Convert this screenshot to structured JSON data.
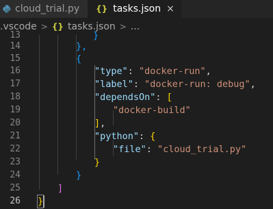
{
  "tabs": [
    {
      "label": "cloud_trial.py",
      "icon": "python-icon",
      "active": false
    },
    {
      "label": "tasks.json",
      "icon": "json-braces-icon",
      "icon_glyph": "{}",
      "active": true,
      "close_glyph": "×"
    }
  ],
  "breadcrumb": {
    "folder": ".vscode",
    "separator": ">",
    "file_icon_glyph": "{}",
    "file": "tasks.json",
    "ellipsis": "..."
  },
  "editor": {
    "current_line": 26,
    "lines": [
      {
        "num": "13",
        "text": "}"
      },
      {
        "num": "14",
        "text": "},"
      },
      {
        "num": "15",
        "text": "{"
      },
      {
        "num": "16",
        "key": "\"type\"",
        "colon": ": ",
        "value": "\"docker-run\"",
        "end": ","
      },
      {
        "num": "17",
        "key": "\"label\"",
        "colon": ": ",
        "value": "\"docker-run: debug\"",
        "end": ","
      },
      {
        "num": "18",
        "key": "\"dependsOn\"",
        "colon": ": ",
        "bracket": "["
      },
      {
        "num": "19",
        "value": "\"docker-build\""
      },
      {
        "num": "20",
        "bracket": "]",
        "end": ","
      },
      {
        "num": "21",
        "key": "\"python\"",
        "colon": ": ",
        "bracket": "{"
      },
      {
        "num": "22",
        "key": "\"file\"",
        "colon": ": ",
        "value": "\"cloud_trial.py\""
      },
      {
        "num": "23",
        "bracket": "}"
      },
      {
        "num": "24",
        "bracket": "}"
      },
      {
        "num": "25",
        "bracket": "]"
      },
      {
        "num": "26",
        "bracket": "}"
      }
    ]
  },
  "colors": {
    "background": "#1e1e1e",
    "key": "#9cdcfe",
    "string": "#ce9178",
    "bracket_gold": "#ffd700",
    "bracket_purple": "#da70d6",
    "bracket_blue": "#179fff"
  }
}
